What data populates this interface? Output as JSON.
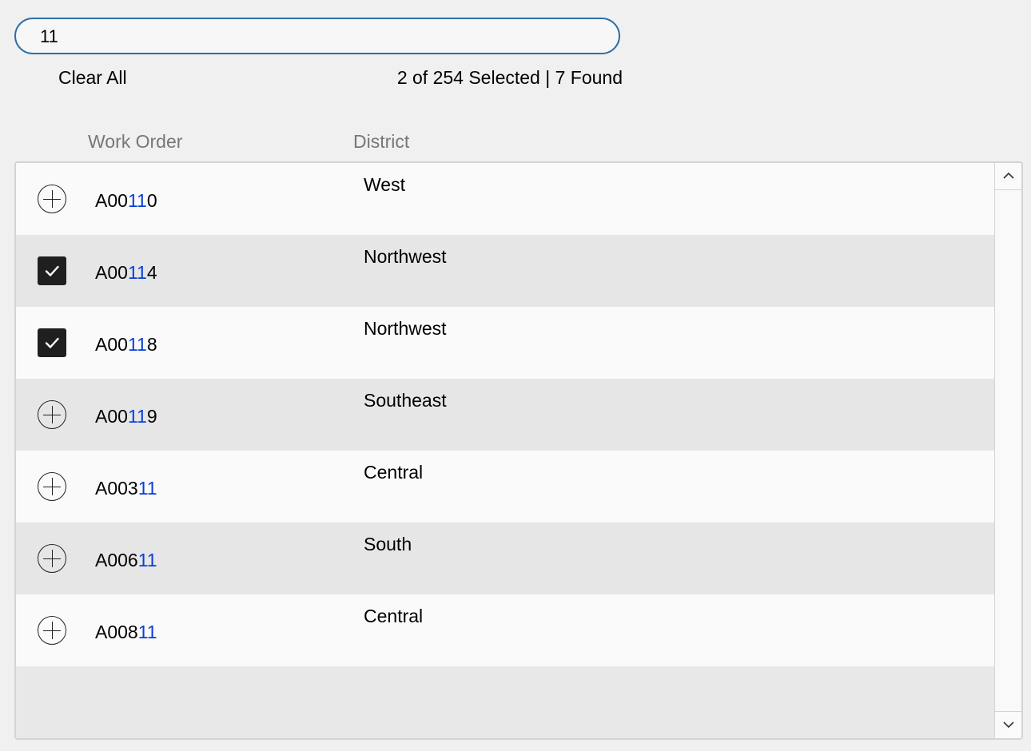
{
  "search": {
    "value": "11"
  },
  "clear_all_label": "Clear All",
  "status_text": "2 of 254 Selected | 7 Found",
  "columns": {
    "work_order": "Work Order",
    "district": "District"
  },
  "highlight_color": "#0a3fd6",
  "rows": [
    {
      "wo_pre": "A00",
      "wo_hl": "11",
      "wo_post": "0",
      "district": "West",
      "selected": false
    },
    {
      "wo_pre": "A00",
      "wo_hl": "11",
      "wo_post": "4",
      "district": "Northwest",
      "selected": true
    },
    {
      "wo_pre": "A00",
      "wo_hl": "11",
      "wo_post": "8",
      "district": "Northwest",
      "selected": true
    },
    {
      "wo_pre": "A00",
      "wo_hl": "11",
      "wo_post": "9",
      "district": "Southeast",
      "selected": false
    },
    {
      "wo_pre": "A003",
      "wo_hl": "11",
      "wo_post": "",
      "district": "Central",
      "selected": false
    },
    {
      "wo_pre": "A006",
      "wo_hl": "11",
      "wo_post": "",
      "district": "South",
      "selected": false
    },
    {
      "wo_pre": "A008",
      "wo_hl": "11",
      "wo_post": "",
      "district": "Central",
      "selected": false
    }
  ],
  "icons": {
    "unselected": "plus-circle-icon",
    "selected": "checkbox-checked-icon",
    "scroll_up": "chevron-up-icon",
    "scroll_down": "chevron-down-icon"
  }
}
